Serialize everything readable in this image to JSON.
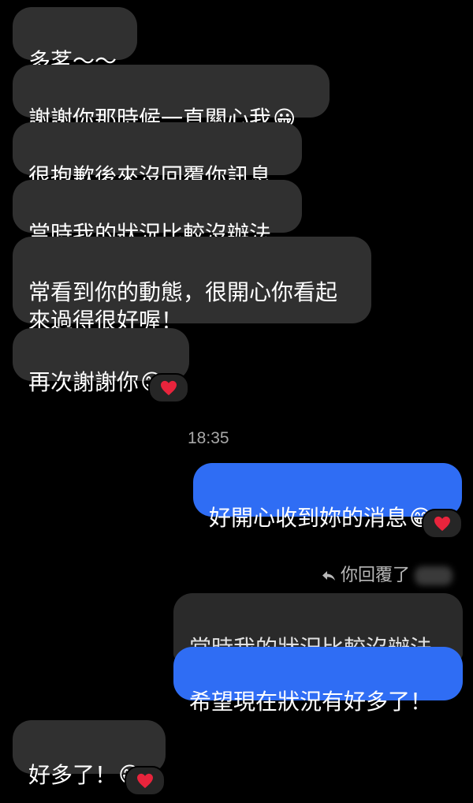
{
  "chat": {
    "incoming": [
      {
        "text": "多茗～～",
        "emoji": ""
      },
      {
        "text": "謝謝你那時候一直關心我",
        "emoji": "😀"
      },
      {
        "text": "很抱歉後來沒回覆你訊息",
        "emoji": ""
      },
      {
        "text": "當時我的狀況比較沒辦法",
        "emoji": ""
      },
      {
        "text": "常看到你的動態，很開心你看起\n來過得很好喔！",
        "emoji": ""
      },
      {
        "text": "再次謝謝你",
        "emoji": "😊"
      }
    ],
    "timestamp": "18:35",
    "outgoing_1": {
      "text": "好開心收到妳的消息",
      "emoji": "😁"
    },
    "reply_label": "你回覆了",
    "quoted_text": "當時我的狀況比較沒辦法",
    "outgoing_2": {
      "text": "希望現在狀況有好多了！",
      "emoji": ""
    },
    "incoming_last": {
      "text": "好多了！",
      "emoji": "😁"
    }
  },
  "reaction": {
    "icon": "heart-icon",
    "color": "#e8243c"
  }
}
